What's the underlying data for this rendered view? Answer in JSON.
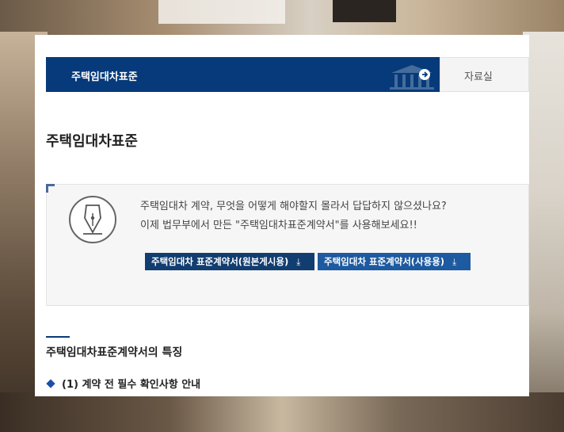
{
  "topbar": {
    "active_label": "주택임대차표준",
    "other_label": "자료실"
  },
  "page_title": "주택임대차표준",
  "info": {
    "line1": "주택임대차 계약, 무엇을 어떻게 해야할지 몰라서 답답하지 않으셨나요?",
    "line2": "이제 법무부에서 만든 \"주택임대차표준계약서\"를 사용해보세요!!",
    "button_original": "주택임대차 표준계약서(원본게시용)",
    "button_use": "주택임대차 표준계약서(사용용)",
    "download_glyph": "⤓"
  },
  "section": {
    "title": "주택임대차표준계약서의 특징",
    "item1": "(1) 계약 전 필수 확인사항 안내"
  },
  "colors": {
    "primary": "#063a7a",
    "button_dark": "#123d70",
    "button_light": "#1d5aa0",
    "bullet": "#1d4fa8"
  }
}
